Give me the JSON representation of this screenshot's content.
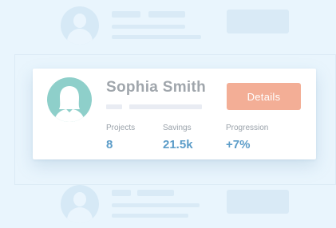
{
  "profile": {
    "name": "Sophia Smith",
    "details_button_label": "Details"
  },
  "stats": [
    {
      "label": "Projects",
      "value": "8"
    },
    {
      "label": "Savings",
      "value": "21.5k"
    },
    {
      "label": "Progression",
      "value": "+7%"
    }
  ],
  "colors": {
    "page_background": "#e9f5fd",
    "card_background": "#ffffff",
    "avatar_background": "#8ecfca",
    "details_button": "#f3ae96",
    "name_text": "#a0a6ac",
    "stat_label": "#9aa2aa",
    "stat_value": "#5b9cc8"
  },
  "icons": {
    "avatar": "user-silhouette-icon"
  }
}
